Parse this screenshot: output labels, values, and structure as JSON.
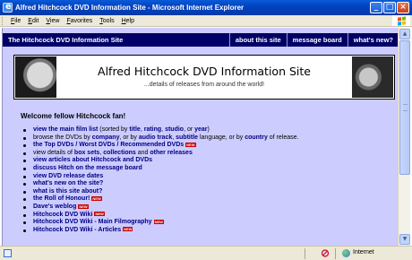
{
  "window": {
    "title": "Alfred Hitchcock DVD Information Site - Microsoft Internet Explorer"
  },
  "menu": [
    "File",
    "Edit",
    "View",
    "Favorites",
    "Tools",
    "Help"
  ],
  "sitenav": {
    "site_name": "The Hitchcock DVD Information Site",
    "links": [
      "about this site",
      "message board",
      "what's new?"
    ]
  },
  "banner": {
    "title": "Alfred Hitchcock DVD Information Site",
    "subtitle": "...details of releases from around the world!"
  },
  "welcome": "Welcome fellow Hitchcock fan!",
  "list": {
    "item1": {
      "link": "view the main film list",
      "t1": " (sorted by ",
      "l1": "title",
      "t2": ", ",
      "l2": "rating",
      "t3": ", ",
      "l3": "studio",
      "t4": ", or ",
      "l4": "year",
      "t5": ")"
    },
    "item2": {
      "t0": "browse the DVDs by ",
      "l1": "company",
      "t1": ", or by ",
      "l2": "audio track",
      "t2": ", ",
      "l3": "subtitle",
      "t3": " language, or by ",
      "l4": "country",
      "t4": " of release."
    },
    "item3": {
      "link": "the Top DVDs / Worst DVDs / Recommended DVDs"
    },
    "item4": {
      "t0": "view details of ",
      "l1": "box sets",
      "t1": ", ",
      "l2": "collections",
      "t2": " and ",
      "l3": "other releases"
    },
    "item5": "view articles about Hitchcock and DVDs",
    "item6": "discuss Hitch on the message board",
    "item7": "view DVD release dates",
    "item8": "what's new on the site?",
    "item9": "what is this site about?",
    "item10": "the Roll of Honour!",
    "item11": "Dave's weblog",
    "item12": "Hitchcock DVD Wiki",
    "item13": "Hitchcock DVD Wiki - Main Filmography",
    "item14": "Hitchcock DVD Wiki - Articles",
    "badge": "NEW"
  },
  "status": {
    "zone": "Internet"
  }
}
